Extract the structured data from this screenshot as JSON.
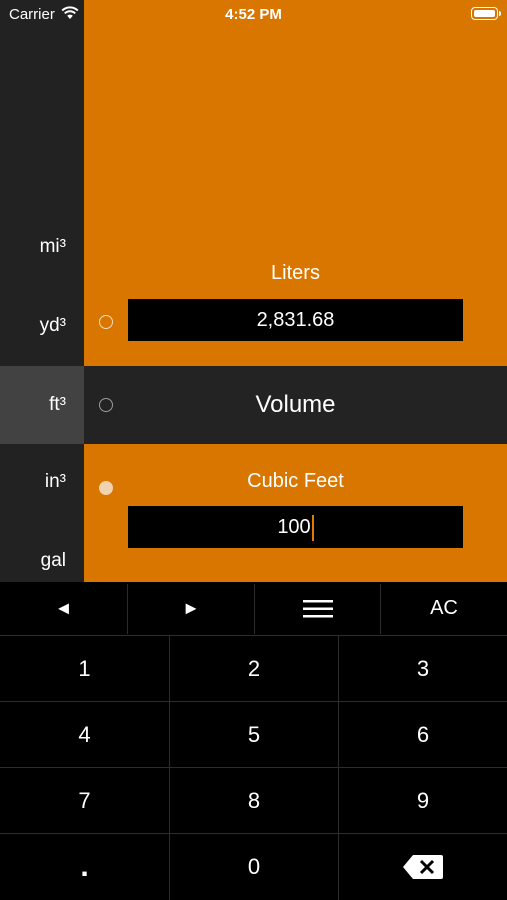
{
  "status_bar": {
    "carrier": "Carrier",
    "time": "4:52 PM"
  },
  "sidebar": {
    "units": [
      "mi³",
      "yd³",
      "ft³",
      "in³",
      "gal"
    ],
    "selected": "ft³"
  },
  "top_field": {
    "title": "Liters",
    "value": "2,831.68"
  },
  "category": {
    "label": "Volume"
  },
  "bottom_field": {
    "title": "Cubic Feet",
    "value": "100"
  },
  "toolbar": {
    "prev_label": "◄",
    "next_label": "►",
    "menu_label": "☰",
    "clear_label": "AC"
  },
  "keypad": {
    "keys": [
      "1",
      "2",
      "3",
      "4",
      "5",
      "6",
      "7",
      "8",
      "9",
      ".",
      "0"
    ],
    "backspace_icon": "backspace-icon"
  },
  "colors": {
    "accent": "#d87600",
    "sidebar": "#222222",
    "selected_unit": "#424242",
    "category_bar": "#232323"
  }
}
